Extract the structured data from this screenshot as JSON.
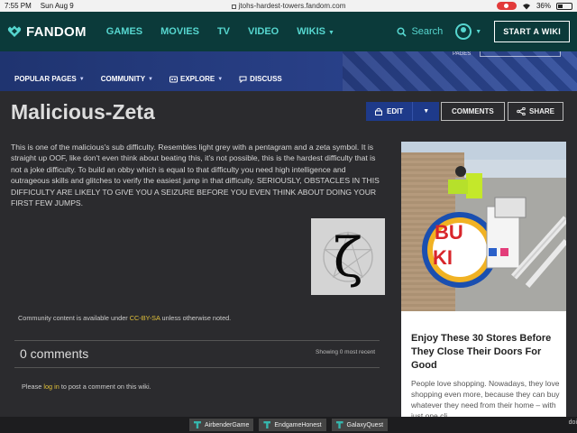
{
  "status_bar": {
    "time": "7:55 PM",
    "date": "Sun Aug 9",
    "url": "jtohs-hardest-towers.fandom.com",
    "battery": "36%"
  },
  "top_nav": {
    "brand": "FANDOM",
    "links": [
      "GAMES",
      "MOVIES",
      "TV",
      "VIDEO",
      "WIKIS"
    ],
    "search_label": "Search",
    "start_wiki": "START A WIKI"
  },
  "banner": {
    "pages_mark": "PAGES"
  },
  "wiki_nav": {
    "items": [
      "POPULAR PAGES",
      "COMMUNITY",
      "EXPLORE",
      "DISCUSS"
    ]
  },
  "page": {
    "title": "Malicious-Zeta",
    "edit_label": "EDIT",
    "comments_label": "COMMENTS",
    "share_label": "SHARE",
    "body_text": "This is one of the malicious's sub difficulty. Resembles light grey with a pentagram and a zeta symbol. It is straight up OOF, like don't even think about beating this, it's not possible, this is the hardest difficulty that is not a joke difficulty. To build an obby which is equal to that difficulty you need high intelligence and outrageous skills and glitches to verify the easiest jump in that difficulty. SERIOUSLY, OBSTACLES IN THIS DIFFICULTY ARE LIKELY TO GIVE YOU A SEIZURE BEFORE YOU EVEN THINK ABOUT DOING YOUR FIRST FEW JUMPS.",
    "glyph": "ζ"
  },
  "license": {
    "before": "Community content is available under ",
    "link": "CC-BY-SA",
    "after": " unless otherwise noted."
  },
  "comments": {
    "title": "0 comments",
    "showing": "Showing 0 most recent",
    "login_before": "Please ",
    "login_link": "log in",
    "login_after": " to post a comment on this wiki."
  },
  "ad": {
    "title": "Enjoy These 30 Stores Before They Close Their Doors For Good",
    "text": "People love shopping. Nowadays, they love shopping even more, because they can buy whatever they need from their home – with just one cli",
    "sign_letters_top": "BU",
    "sign_letters_bottom": "KI"
  },
  "bottom_tabs": [
    "AirbenderGame",
    "EndgameHonest",
    "GalaxyQuest"
  ],
  "bottom_edge": "doi",
  "colors": {
    "nav_bg": "#0b3a3a",
    "accent": "#56d6cf",
    "banner_bg": "#283f86",
    "edit_bg": "#1e3a8a",
    "link": "#e0c03a",
    "page_bg": "#2b2b2e"
  }
}
